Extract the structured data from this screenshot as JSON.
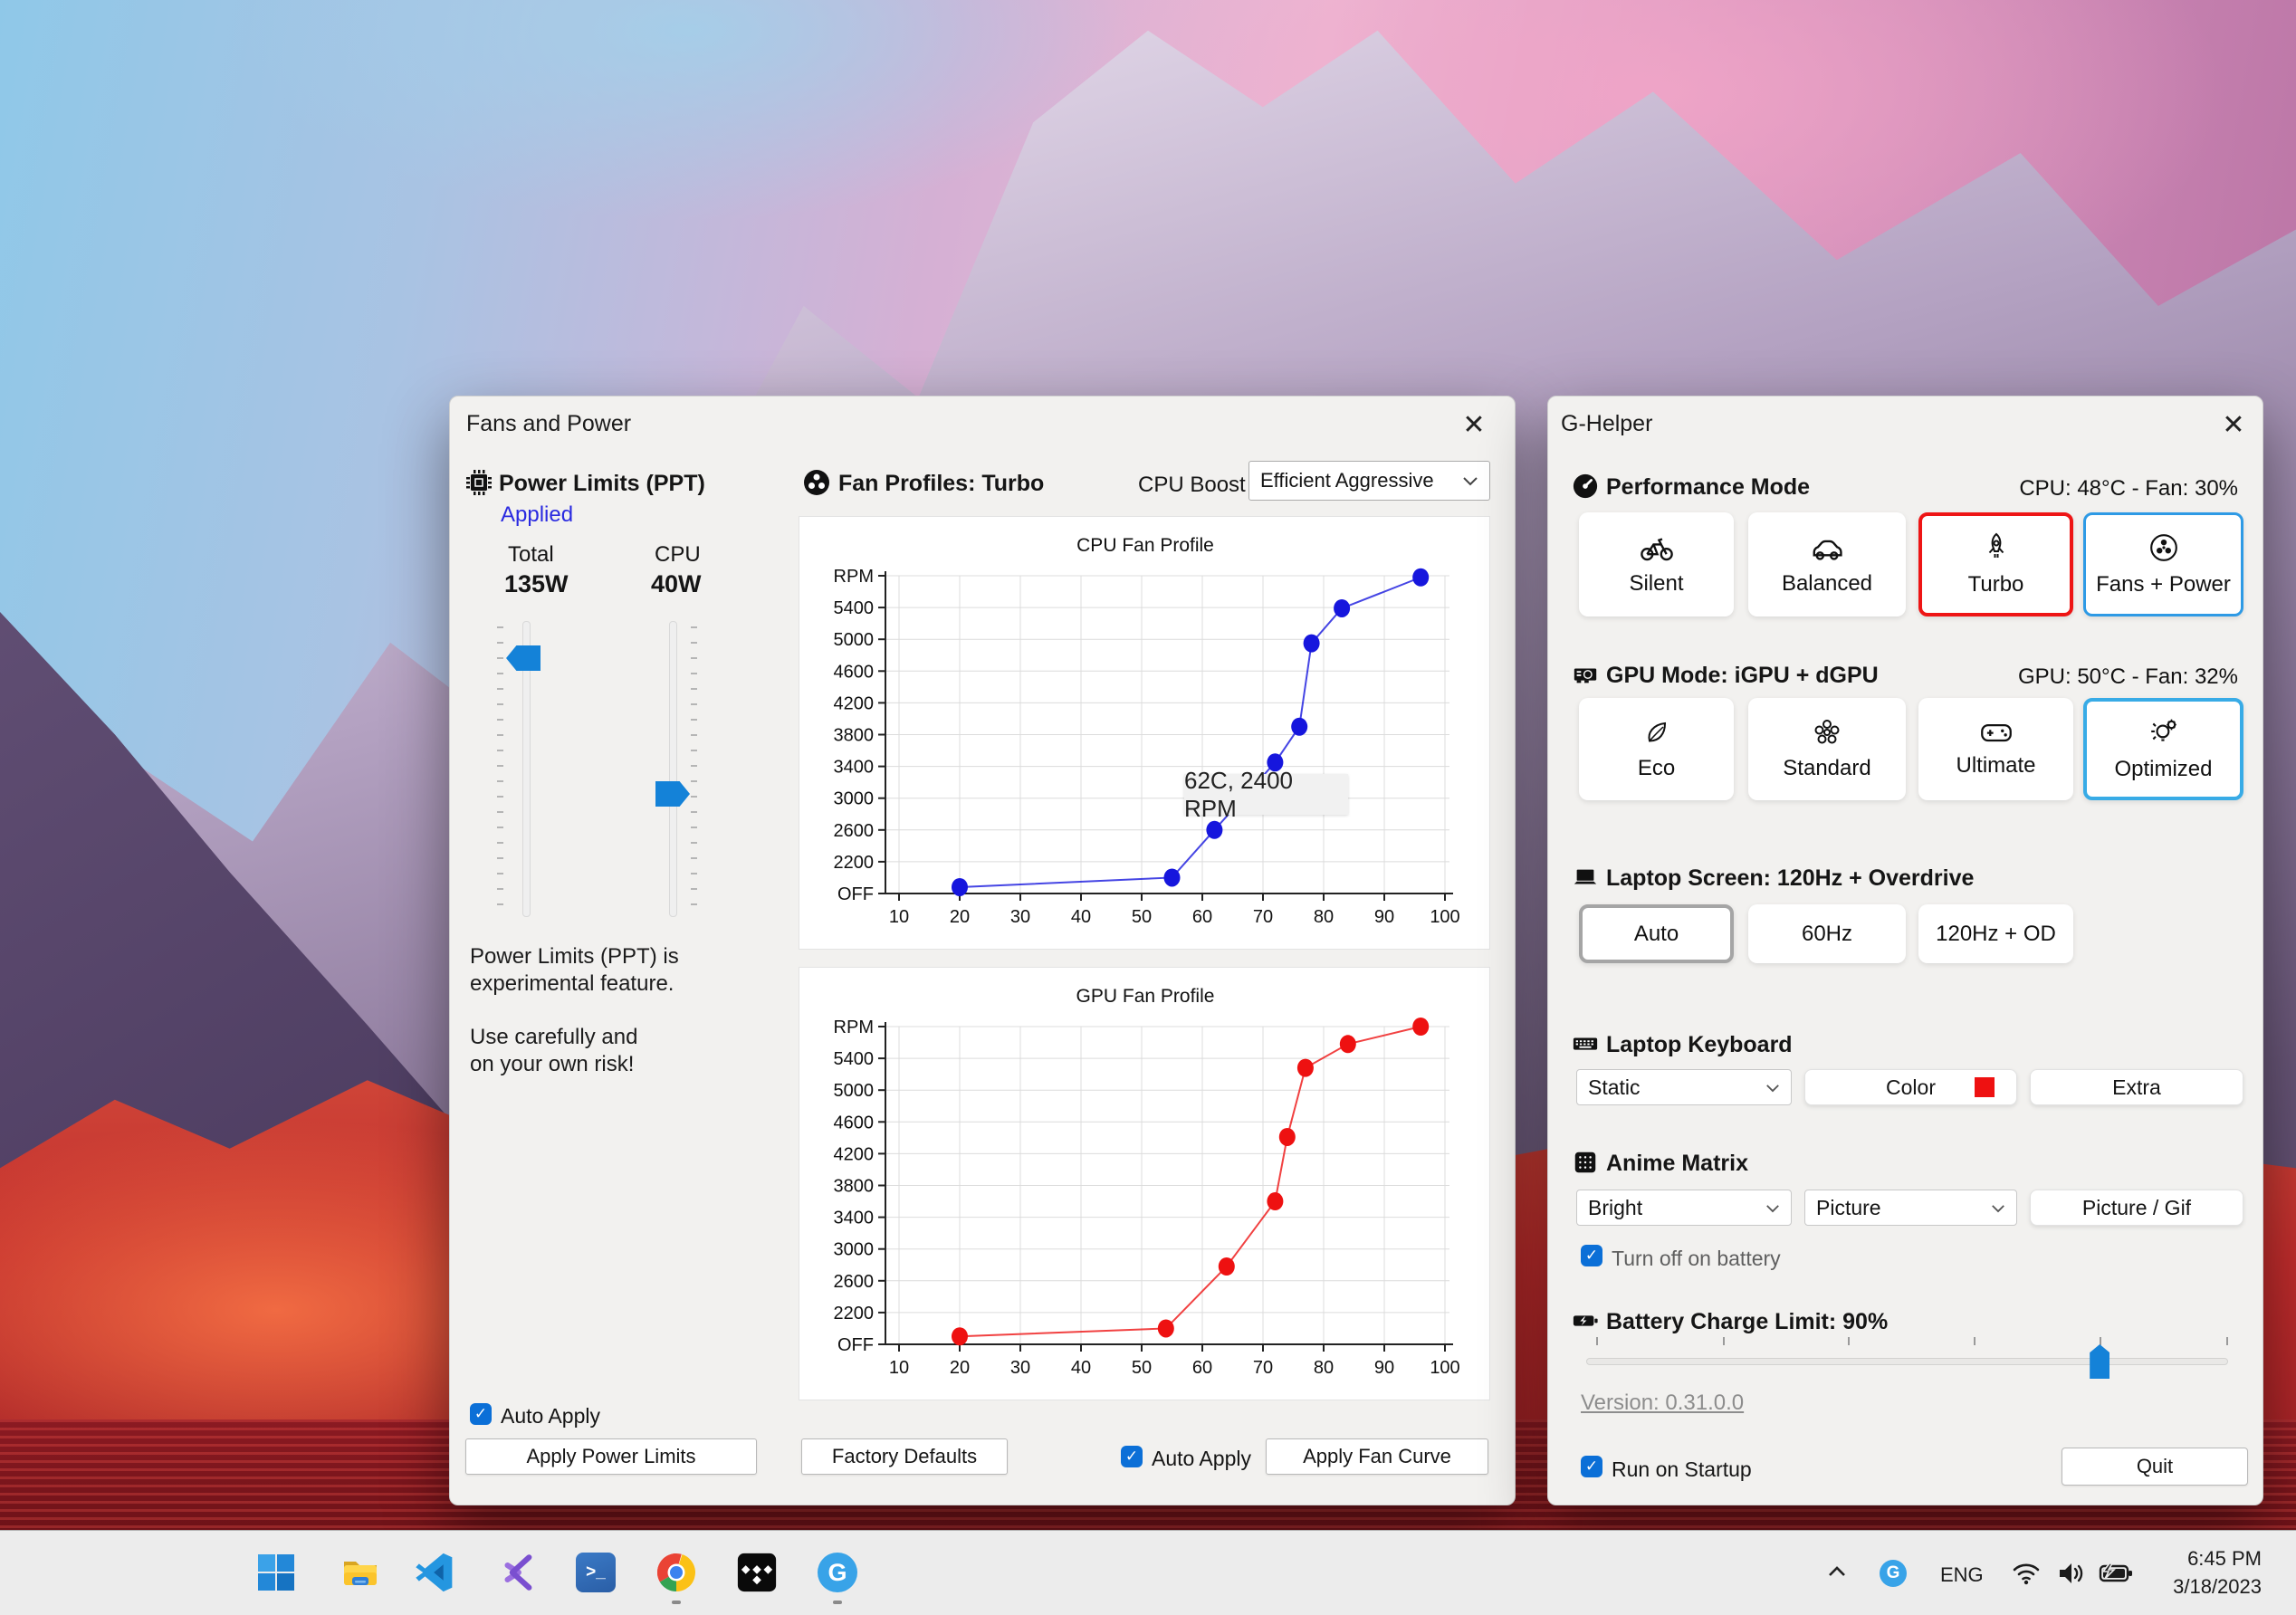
{
  "colors": {
    "accent_blue": "#0b6fd7",
    "turbo_red": "#ee1515",
    "selected_blue": "#2e9ae5",
    "applied_text": "#2a2ae0",
    "keyboard_color_swatch": "#ee1111",
    "cpu_curve": "#1616dd",
    "gpu_curve": "#ee1111"
  },
  "fans_window": {
    "title": "Fans and Power",
    "close_glyph": "✕",
    "power_limits": {
      "header": "Power Limits (PPT)",
      "status": "Applied",
      "total_label": "Total",
      "total_value": "135W",
      "cpu_label": "CPU",
      "cpu_value": "40W",
      "note_line1": "Power Limits (PPT) is",
      "note_line2": "experimental feature.",
      "note_line3": "Use carefully and",
      "note_line4": "on your own risk!",
      "auto_apply_label": "Auto Apply",
      "apply_button": "Apply Power Limits"
    },
    "fan_profiles": {
      "header": "Fan Profiles: Turbo",
      "cpu_boost_label": "CPU Boost",
      "cpu_boost_value": "Efficient Aggressive",
      "factory_defaults_button": "Factory Defaults",
      "auto_apply_label": "Auto Apply",
      "apply_button": "Apply Fan Curve"
    }
  },
  "chart_data": [
    {
      "type": "line",
      "title": "CPU Fan Profile",
      "x_ticks": [
        10,
        20,
        30,
        40,
        50,
        60,
        70,
        80,
        90,
        100
      ],
      "x_range": [
        10,
        100
      ],
      "y_ticks": [
        {
          "label": "OFF",
          "value": 1800
        },
        {
          "label": "2200",
          "value": 2200
        },
        {
          "label": "2600",
          "value": 2600
        },
        {
          "label": "3000",
          "value": 3000
        },
        {
          "label": "3400",
          "value": 3400
        },
        {
          "label": "3800",
          "value": 3800
        },
        {
          "label": "4200",
          "value": 4200
        },
        {
          "label": "4600",
          "value": 4600
        },
        {
          "label": "5000",
          "value": 5000
        },
        {
          "label": "5400",
          "value": 5400
        },
        {
          "label": "RPM",
          "value": 5800
        }
      ],
      "y_range": [
        1800,
        5800
      ],
      "grid": true,
      "series": [
        {
          "name": "CPU fan curve",
          "color": "#1616dd",
          "points": [
            [
              20,
              1880
            ],
            [
              55,
              2000
            ],
            [
              62,
              2600
            ],
            [
              72,
              3450
            ],
            [
              76,
              3900
            ],
            [
              78,
              4950
            ],
            [
              83,
              5390
            ],
            [
              96,
              5780
            ]
          ]
        }
      ],
      "annotation": {
        "text": "62C, 2400 RPM"
      }
    },
    {
      "type": "line",
      "title": "GPU Fan Profile",
      "x_ticks": [
        10,
        20,
        30,
        40,
        50,
        60,
        70,
        80,
        90,
        100
      ],
      "x_range": [
        10,
        100
      ],
      "y_ticks": [
        {
          "label": "OFF",
          "value": 1800
        },
        {
          "label": "2200",
          "value": 2200
        },
        {
          "label": "2600",
          "value": 2600
        },
        {
          "label": "3000",
          "value": 3000
        },
        {
          "label": "3400",
          "value": 3400
        },
        {
          "label": "3800",
          "value": 3800
        },
        {
          "label": "4200",
          "value": 4200
        },
        {
          "label": "4600",
          "value": 4600
        },
        {
          "label": "5000",
          "value": 5000
        },
        {
          "label": "5400",
          "value": 5400
        },
        {
          "label": "RPM",
          "value": 5800
        }
      ],
      "y_range": [
        1800,
        5800
      ],
      "grid": true,
      "series": [
        {
          "name": "GPU fan curve",
          "color": "#ee1111",
          "points": [
            [
              20,
              1900
            ],
            [
              54,
              2000
            ],
            [
              64,
              2780
            ],
            [
              72,
              3600
            ],
            [
              74,
              4410
            ],
            [
              77,
              5280
            ],
            [
              84,
              5580
            ],
            [
              96,
              5800
            ]
          ]
        }
      ]
    }
  ],
  "g_helper": {
    "title": "G-Helper",
    "close_glyph": "✕",
    "performance_mode": {
      "header": "Performance Mode",
      "status": "CPU: 48°C -  Fan: 30%",
      "buttons": [
        {
          "label": "Silent",
          "selected": false
        },
        {
          "label": "Balanced",
          "selected": false
        },
        {
          "label": "Turbo",
          "selected": true
        },
        {
          "label": "Fans + Power",
          "selected": false
        }
      ]
    },
    "gpu_mode": {
      "header": "GPU Mode: iGPU + dGPU",
      "status": "GPU: 50°C -  Fan: 32%",
      "buttons": [
        {
          "label": "Eco",
          "selected": false
        },
        {
          "label": "Standard",
          "selected": false
        },
        {
          "label": "Ultimate",
          "selected": false
        },
        {
          "label": "Optimized",
          "selected": true
        }
      ]
    },
    "laptop_screen": {
      "header": "Laptop Screen: 120Hz + Overdrive",
      "buttons": [
        {
          "label": "Auto",
          "selected": true
        },
        {
          "label": "60Hz",
          "selected": false
        },
        {
          "label": "120Hz + OD",
          "selected": false
        }
      ]
    },
    "laptop_keyboard": {
      "header": "Laptop Keyboard",
      "mode_dropdown_value": "Static",
      "color_button": "Color",
      "extra_button": "Extra"
    },
    "anime_matrix": {
      "header": "Anime Matrix",
      "brightness_dropdown_value": "Bright",
      "mode_dropdown_value": "Picture",
      "picture_button": "Picture / Gif",
      "battery_checkbox_label": "Turn off on battery",
      "battery_checkbox_checked": true
    },
    "battery": {
      "header": "Battery Charge Limit: 90%",
      "limit_percent": 90,
      "slider_position_percent": 80
    },
    "version_link": "Version: 0.31.0.0",
    "run_on_startup_label": "Run on Startup",
    "run_on_startup_checked": true,
    "quit_button": "Quit"
  },
  "taskbar": {
    "pinned": [
      {
        "name": "start"
      },
      {
        "name": "file-explorer"
      },
      {
        "name": "vscode"
      },
      {
        "name": "visual-studio"
      },
      {
        "name": "powershell"
      },
      {
        "name": "chrome",
        "running": true
      },
      {
        "name": "tidal",
        "running": false
      },
      {
        "name": "g-helper",
        "running": true
      }
    ],
    "tray": {
      "language": "ENG"
    },
    "clock": {
      "time": "6:45 PM",
      "date": "3/18/2023"
    }
  }
}
